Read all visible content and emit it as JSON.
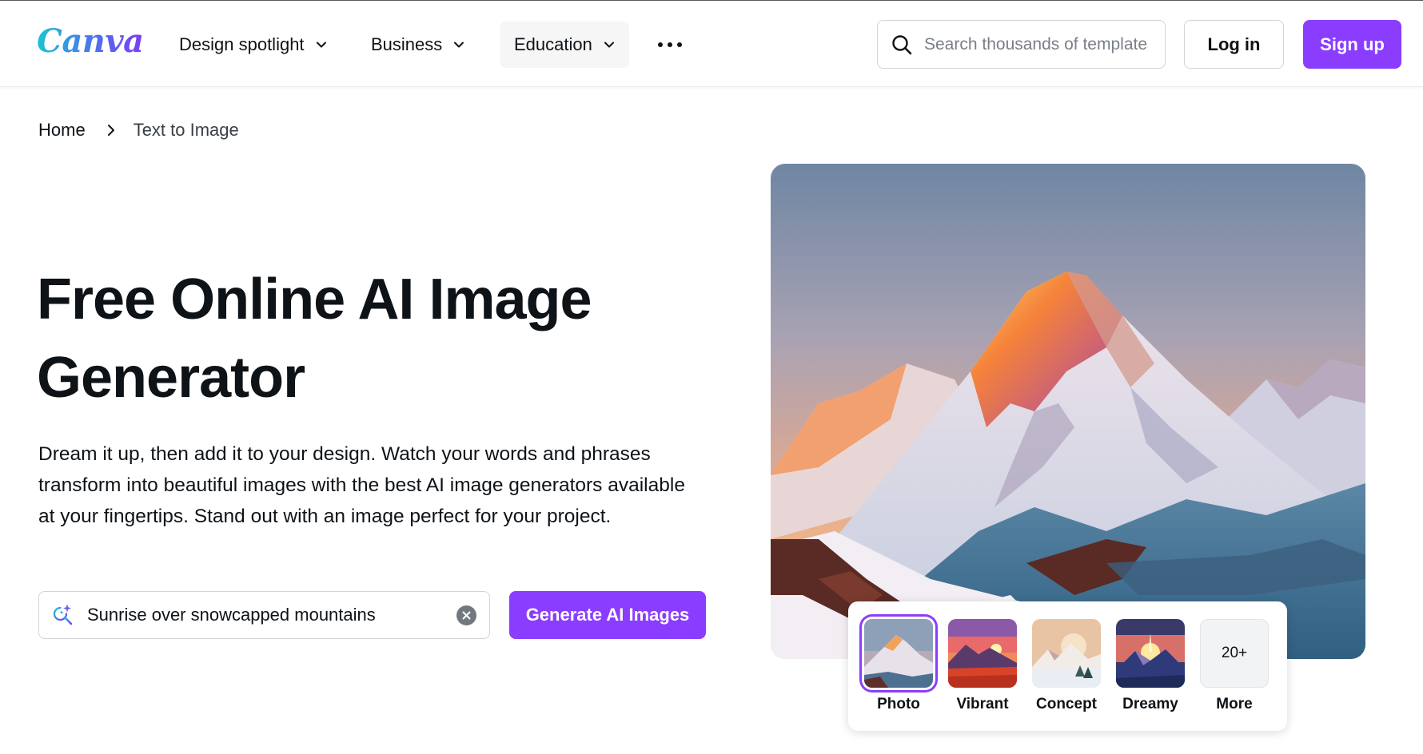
{
  "header": {
    "logo_text": "Canva",
    "nav": [
      {
        "label": "Design spotlight"
      },
      {
        "label": "Business"
      },
      {
        "label": "Education"
      }
    ],
    "more_icon": "more-dots-icon",
    "search": {
      "placeholder": "Search thousands of templates",
      "icon": "search-icon"
    },
    "login_label": "Log in",
    "signup_label": "Sign up"
  },
  "breadcrumb": {
    "home": "Home",
    "current": "Text to Image"
  },
  "hero": {
    "title_line1": "Free Online AI Image",
    "title_line2": "Generator",
    "description": "Dream it up, then add it to your design. Watch your words and phrases transform into beautiful images with the best AI image generators available at your fingertips. Stand out with an image perfect for your project.",
    "prompt_value": "Sunrise over snowcapped mountains",
    "prompt_icon": "ai-search-sparkle-icon",
    "generate_label": "Generate AI Images"
  },
  "styles": {
    "options": [
      {
        "label": "Photo",
        "selected": true
      },
      {
        "label": "Vibrant",
        "selected": false
      },
      {
        "label": "Concept",
        "selected": false
      },
      {
        "label": "Dreamy",
        "selected": false
      }
    ],
    "more_count": "20+",
    "more_label": "More"
  },
  "colors": {
    "brand_purple": "#8b3dff",
    "text": "#0e1318",
    "border": "#d2d4d8"
  }
}
